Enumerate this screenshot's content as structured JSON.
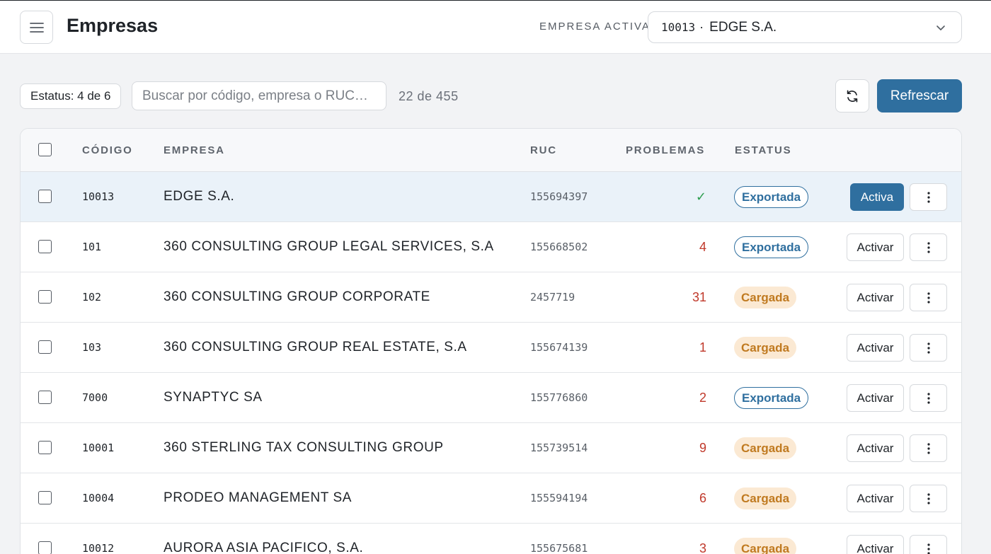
{
  "header": {
    "title": "Empresas",
    "active_company_label": "EMPRESA ACTIVA",
    "active_company": {
      "code": "10013",
      "separator": "·",
      "name": "EDGE S.A."
    }
  },
  "toolbar": {
    "status_filter": "Estatus: 4 de 6",
    "search_placeholder": "Buscar por código, empresa o RUC…",
    "result_count": "22 de 455",
    "refresh_label": "Refrescar"
  },
  "table": {
    "headers": {
      "code": "CÓDIGO",
      "company": "EMPRESA",
      "ruc": "RUC",
      "problems": "PROBLEMAS",
      "status": "ESTATUS"
    },
    "rows": [
      {
        "code": "10013",
        "name": "EDGE S.A.",
        "ruc": "155694397",
        "problems": "✓",
        "status": "Exportada",
        "action": "Activa"
      },
      {
        "code": "101",
        "name": "360 CONSULTING GROUP LEGAL SERVICES, S.A",
        "ruc": "155668502",
        "problems": "4",
        "status": "Exportada",
        "action": "Activar"
      },
      {
        "code": "102",
        "name": "360 CONSULTING GROUP CORPORATE",
        "ruc": "2457719",
        "problems": "31",
        "status": "Cargada",
        "action": "Activar"
      },
      {
        "code": "103",
        "name": "360 CONSULTING GROUP REAL ESTATE, S.A",
        "ruc": "155674139",
        "problems": "1",
        "status": "Cargada",
        "action": "Activar"
      },
      {
        "code": "7000",
        "name": "SYNAPTYC SA",
        "ruc": "155776860",
        "problems": "2",
        "status": "Exportada",
        "action": "Activar"
      },
      {
        "code": "10001",
        "name": "360 STERLING TAX CONSULTING GROUP",
        "ruc": "155739514",
        "problems": "9",
        "status": "Cargada",
        "action": "Activar"
      },
      {
        "code": "10004",
        "name": "PRODEO MANAGEMENT SA",
        "ruc": "155594194",
        "problems": "6",
        "status": "Cargada",
        "action": "Activar"
      },
      {
        "code": "10012",
        "name": "AURORA ASIA PACIFICO, S.A.",
        "ruc": "155675681",
        "problems": "3",
        "status": "Cargada",
        "action": "Activar"
      }
    ]
  },
  "icons": {
    "menu": "hamburger-icon",
    "dropdown": "chevron-down-icon",
    "sync": "sync-icon",
    "more": "more-vertical-icon"
  },
  "colors": {
    "primary": "#2f6f9f",
    "problem": "#c0392b",
    "ok": "#2e9e4f",
    "cargada_bg": "#fbe9d3",
    "cargada_text": "#c07a20",
    "selected_row": "#eaf2f9"
  }
}
